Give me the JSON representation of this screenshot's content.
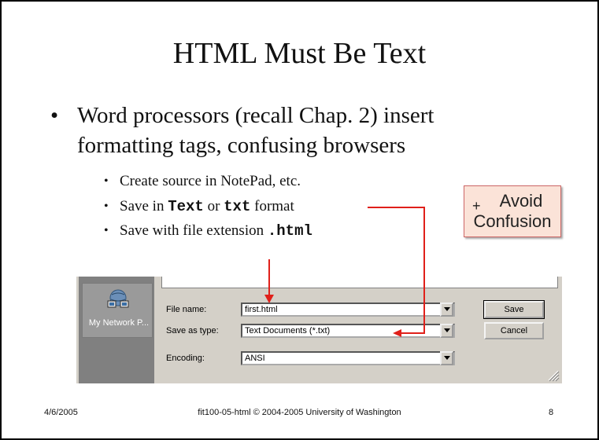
{
  "title": "HTML Must Be Text",
  "bullet_main": "Word processors (recall Chap. 2) insert formatting tags, confusing browsers",
  "sub_bullets": {
    "b1": "Create source in NotePad, etc.",
    "b2_pre": "Save in ",
    "b2_code1": "Text",
    "b2_mid": " or ",
    "b2_code2": "txt",
    "b2_post": " format",
    "b3_pre": "Save with file extension ",
    "b3_code": ".html"
  },
  "callout": {
    "plus": "+",
    "line1": "Avoid",
    "line2": "Confusion"
  },
  "dialog": {
    "side_label": "My Network P...",
    "file_name_label": "File name:",
    "file_name_value": "first.html",
    "save_as_label": "Save as type:",
    "save_as_value": "Text Documents (*.txt)",
    "encoding_label": "Encoding:",
    "encoding_value": "ANSI",
    "save_button": "Save",
    "cancel_button": "Cancel"
  },
  "footer": {
    "date": "4/6/2005",
    "center": "fit100-05-html © 2004-2005 University of Washington",
    "page": "8"
  },
  "colors": {
    "arrow": "#e0201a",
    "callout_bg": "#fbe3d8",
    "dialog_bg": "#d4d0c8"
  }
}
